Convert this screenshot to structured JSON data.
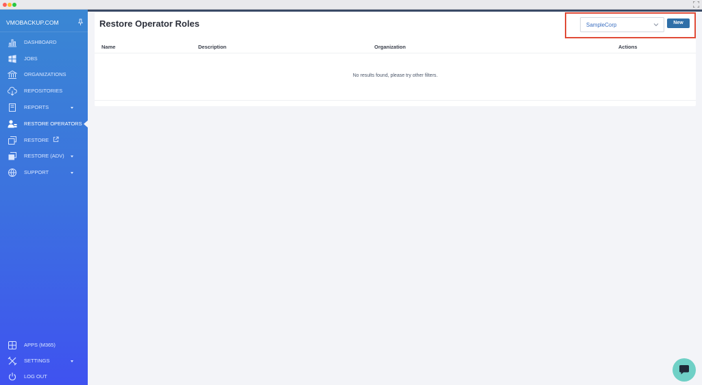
{
  "sidebar": {
    "brand": "VMOBACKUP.COM",
    "items": [
      {
        "label": "DASHBOARD",
        "icon": "bar-chart-icon"
      },
      {
        "label": "JOBS",
        "icon": "windows-icon"
      },
      {
        "label": "ORGANIZATIONS",
        "icon": "bank-icon"
      },
      {
        "label": "REPOSITORIES",
        "icon": "cloud-download-icon"
      },
      {
        "label": "REPORTS",
        "icon": "report-icon"
      },
      {
        "label": "RESTORE OPERATORS",
        "icon": "users-icon"
      },
      {
        "label": "RESTORE",
        "icon": "restore-icon"
      },
      {
        "label": "RESTORE (ADV)",
        "icon": "restore-adv-icon"
      },
      {
        "label": "SUPPORT",
        "icon": "globe-icon"
      }
    ],
    "bottom_items": [
      {
        "label": "APPS (M365)",
        "icon": "apps-icon"
      },
      {
        "label": "SETTINGS",
        "icon": "tools-icon"
      },
      {
        "label": "LOG OUT",
        "icon": "power-icon"
      }
    ]
  },
  "main": {
    "title": "Restore Operator Roles",
    "org_select": {
      "value": "SampleCorp"
    },
    "new_button": "New",
    "columns": [
      "Name",
      "Description",
      "Organization",
      "Actions"
    ],
    "empty_message": "No results found, please try other filters."
  },
  "colors": {
    "sidebar_top": "#3a87d3",
    "sidebar_bottom": "#3f52f0",
    "primary_button": "#2f6fa8",
    "highlight": "#e04a36",
    "chat": "#6fd0c6"
  }
}
